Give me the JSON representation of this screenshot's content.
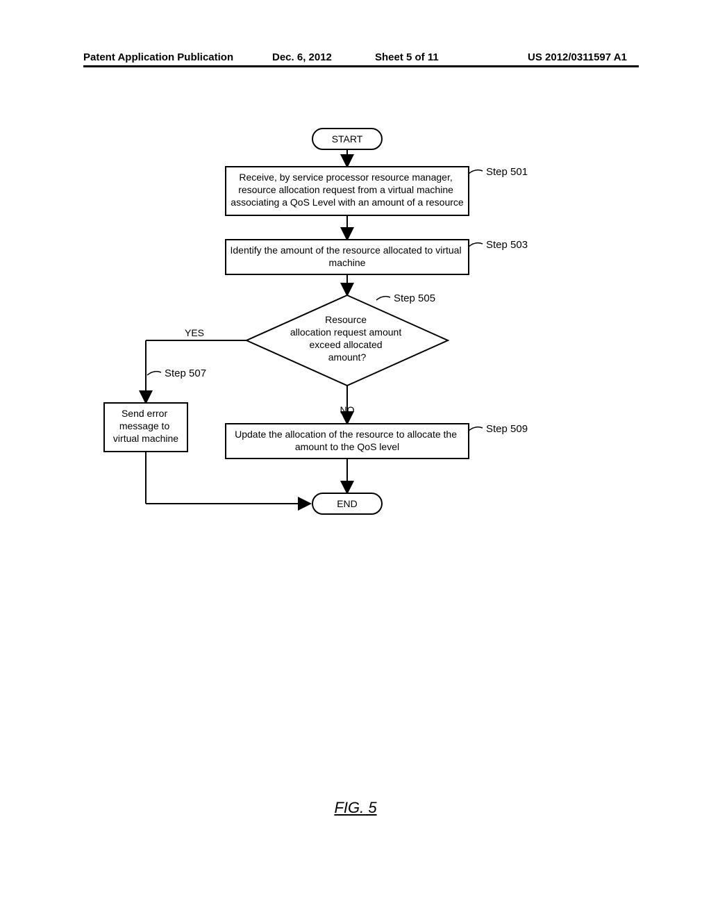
{
  "header": {
    "left": "Patent Application Publication",
    "date": "Dec. 6, 2012",
    "sheet": "Sheet 5 of 11",
    "pubno": "US 2012/0311597 A1"
  },
  "figure_label": "FIG. 5",
  "start": "START",
  "end": "END",
  "yes": "YES",
  "no": "NO",
  "steps": {
    "s501": {
      "label": "Step 501",
      "l1": "Receive, by service processor resource manager,",
      "l2": "resource allocation request from a virtual machine",
      "l3": "associating a QoS Level with an amount of a resource"
    },
    "s503": {
      "label": "Step 503",
      "l1": "Identify the amount of the resource allocated to virtual",
      "l2": "machine"
    },
    "s505": {
      "label": "Step 505",
      "l1": "Resource",
      "l2": "allocation request amount",
      "l3": "exceed allocated",
      "l4": "amount?"
    },
    "s507": {
      "label": "Step 507",
      "l1": "Send error",
      "l2": "message to",
      "l3": "virtual machine"
    },
    "s509": {
      "label": "Step 509",
      "l1": "Update the allocation of the resource to allocate the",
      "l2": "amount to the QoS level"
    }
  }
}
